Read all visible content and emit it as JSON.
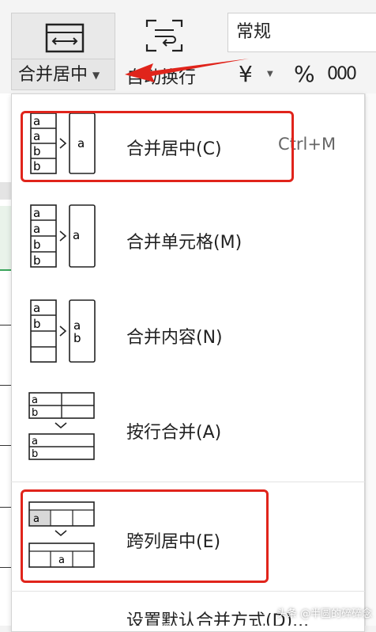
{
  "toolbar": {
    "merge_center_label": "合并居中",
    "wrap_text_label": "自动换行",
    "number_format_value": "常规",
    "currency_glyph": "¥",
    "percent_glyph": "%",
    "thousands_glyph": "000"
  },
  "menu": {
    "items": [
      {
        "label": "合并居中(C)",
        "shortcut": "Ctrl+M",
        "icon": "merge-center-icon"
      },
      {
        "label": "合并单元格(M)",
        "icon": "merge-cells-icon"
      },
      {
        "label": "合并内容(N)",
        "icon": "merge-content-icon"
      },
      {
        "label": "按行合并(A)",
        "icon": "merge-by-row-icon"
      },
      {
        "label": "跨列居中(E)",
        "icon": "center-across-columns-icon"
      },
      {
        "label": "设置默认合并方式(D)..."
      }
    ]
  },
  "icon_letters": {
    "a": "a",
    "b": "b"
  },
  "watermark": "头条 @半圆的碎碎念",
  "colors": {
    "highlight": "#e0241b",
    "accent_green": "#3aa55b"
  }
}
